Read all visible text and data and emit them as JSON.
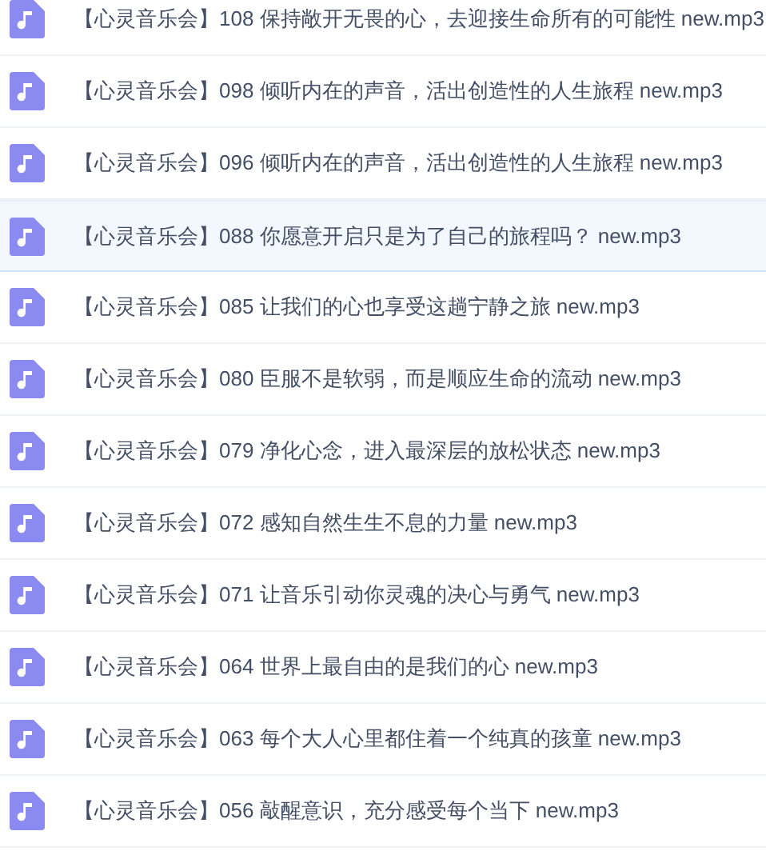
{
  "files": [
    {
      "name": "【心灵音乐会】108 保持敞开无畏的心，去迎接生命所有的可能性 new.mp3",
      "selected": false
    },
    {
      "name": "【心灵音乐会】098 倾听内在的声音，活出创造性的人生旅程 new.mp3",
      "selected": false
    },
    {
      "name": "【心灵音乐会】096 倾听内在的声音，活出创造性的人生旅程 new.mp3",
      "selected": false
    },
    {
      "name": "【心灵音乐会】088 你愿意开启只是为了自己的旅程吗？ new.mp3",
      "selected": true
    },
    {
      "name": "【心灵音乐会】085 让我们的心也享受这趟宁静之旅 new.mp3",
      "selected": false
    },
    {
      "name": "【心灵音乐会】080 臣服不是软弱，而是顺应生命的流动 new.mp3",
      "selected": false
    },
    {
      "name": "【心灵音乐会】079 净化心念，进入最深层的放松状态 new.mp3",
      "selected": false
    },
    {
      "name": "【心灵音乐会】072 感知自然生生不息的力量 new.mp3",
      "selected": false
    },
    {
      "name": "【心灵音乐会】071 让音乐引动你灵魂的决心与勇气 new.mp3",
      "selected": false
    },
    {
      "name": "【心灵音乐会】064 世界上最自由的是我们的心 new.mp3",
      "selected": false
    },
    {
      "name": "【心灵音乐会】063 每个大人心里都住着一个纯真的孩童 new.mp3",
      "selected": false
    },
    {
      "name": "【心灵音乐会】056 敲醒意识，充分感受每个当下 new.mp3",
      "selected": false
    }
  ]
}
